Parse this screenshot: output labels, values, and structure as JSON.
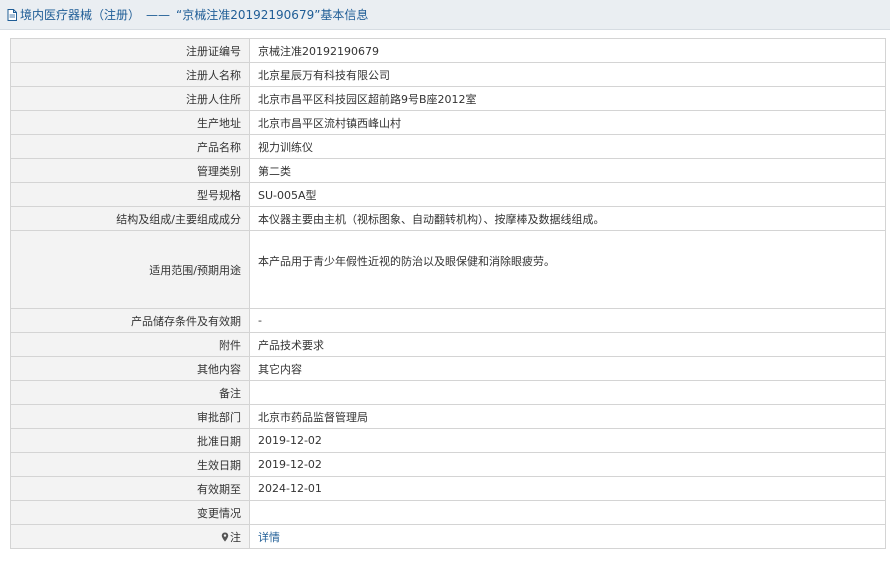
{
  "header": {
    "category": "境内医疗器械（注册）",
    "separator": "——",
    "record_title": "“京械注准20192190679”基本信息",
    "icon": "document-icon"
  },
  "rows": [
    {
      "label": "注册证编号",
      "value": "京械注准20192190679"
    },
    {
      "label": "注册人名称",
      "value": "北京星辰万有科技有限公司"
    },
    {
      "label": "注册人住所",
      "value": "北京市昌平区科技园区超前路9号B座2012室"
    },
    {
      "label": "生产地址",
      "value": "北京市昌平区流村镇西峰山村"
    },
    {
      "label": "产品名称",
      "value": "视力训练仪"
    },
    {
      "label": "管理类别",
      "value": "第二类"
    },
    {
      "label": "型号规格",
      "value": "SU-005A型"
    },
    {
      "label": "结构及组成/主要组成成分",
      "value": "本仪器主要由主机（视标图象、自动翻转机构）、按摩棒及数据线组成。"
    },
    {
      "label": "适用范围/预期用途",
      "value": "本产品用于青少年假性近视的防治以及眼保健和消除眼疲劳。"
    },
    {
      "label": "产品储存条件及有效期",
      "value": "-"
    },
    {
      "label": "附件",
      "value": "产品技术要求"
    },
    {
      "label": "其他内容",
      "value": "其它内容"
    },
    {
      "label": "备注",
      "value": ""
    },
    {
      "label": "审批部门",
      "value": "北京市药品监督管理局"
    },
    {
      "label": "批准日期",
      "value": "2019-12-02"
    },
    {
      "label": "生效日期",
      "value": "2019-12-02"
    },
    {
      "label": "有效期至",
      "value": "2024-12-01"
    },
    {
      "label": "变更情况",
      "value": ""
    }
  ],
  "note": {
    "label": "注",
    "icon": "map-pin-icon",
    "link_text": "详情"
  },
  "colors": {
    "link": "#1f5d96",
    "label_bg": "#f3f3f3",
    "header_bg": "#eaeef2",
    "border": "#d4d4d4"
  }
}
